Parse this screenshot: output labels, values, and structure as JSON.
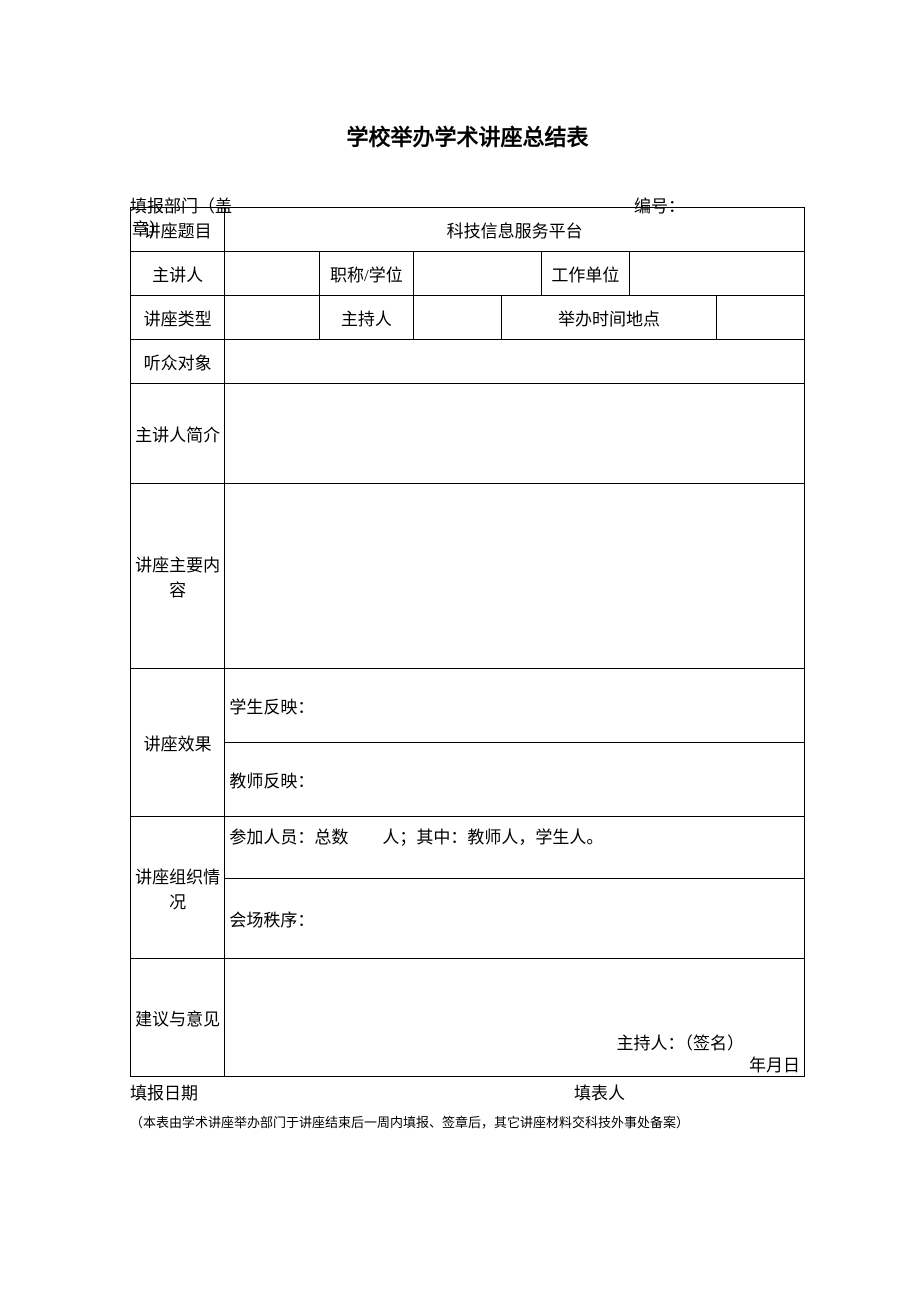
{
  "title": "学校举办学术讲座总结表",
  "header": {
    "dept_label": "填报部门（盖",
    "dept_label2": "章）",
    "number_label": "编号："
  },
  "rows": {
    "topic_label": "讲座题目",
    "topic_value": "科技信息服务平台",
    "speaker_label": "主讲人",
    "title_degree_label": "职称/学位",
    "workplace_label": "工作单位",
    "type_label": "讲座类型",
    "host_label": "主持人",
    "timeplace_label": "举办时间地点",
    "audience_label": "听众对象",
    "bio_label": "主讲人简介",
    "content_label": "讲座主要内容",
    "effect_label": "讲座效果",
    "student_label": "学生反映：",
    "teacher_label": "教师反映：",
    "org_label": "讲座组织情况",
    "attend_text": "参加人员：总数　　人；其中：教师人，学生人。",
    "order_label": "会场秩序：",
    "suggest_label": "建议与意见",
    "sign_label": "主持人：（签名）",
    "date_label": "年月日"
  },
  "footer": {
    "date_label": "填报日期",
    "filler_label": "填表人",
    "note": "（本表由学术讲座举办部门于讲座结束后一周内填报、签章后，其它讲座材料交科技外事处备案）"
  }
}
